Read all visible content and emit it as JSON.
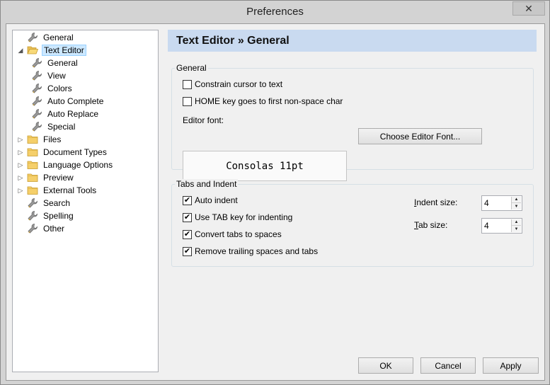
{
  "window": {
    "title": "Preferences",
    "close_glyph": "✕"
  },
  "tree": {
    "items": [
      {
        "label": "General",
        "icon": "wrench-icon",
        "level": 0,
        "expander": ""
      },
      {
        "label": "Text Editor",
        "icon": "folder-open-icon",
        "level": 0,
        "expander": "◢",
        "selected": true
      },
      {
        "label": "General",
        "icon": "wrench-icon",
        "level": 1,
        "expander": ""
      },
      {
        "label": "View",
        "icon": "wrench-icon",
        "level": 1,
        "expander": ""
      },
      {
        "label": "Colors",
        "icon": "wrench-icon",
        "level": 1,
        "expander": ""
      },
      {
        "label": "Auto Complete",
        "icon": "wrench-icon",
        "level": 1,
        "expander": ""
      },
      {
        "label": "Auto Replace",
        "icon": "wrench-icon",
        "level": 1,
        "expander": ""
      },
      {
        "label": "Special",
        "icon": "wrench-icon",
        "level": 1,
        "expander": ""
      },
      {
        "label": "Files",
        "icon": "folder-icon",
        "level": 0,
        "expander": "▷"
      },
      {
        "label": "Document Types",
        "icon": "folder-icon",
        "level": 0,
        "expander": "▷"
      },
      {
        "label": "Language Options",
        "icon": "folder-icon",
        "level": 0,
        "expander": "▷"
      },
      {
        "label": "Preview",
        "icon": "folder-icon",
        "level": 0,
        "expander": "▷"
      },
      {
        "label": "External Tools",
        "icon": "folder-icon",
        "level": 0,
        "expander": "▷"
      },
      {
        "label": "Search",
        "icon": "wrench-icon",
        "level": 0,
        "expander": ""
      },
      {
        "label": "Spelling",
        "icon": "wrench-icon",
        "level": 0,
        "expander": ""
      },
      {
        "label": "Other",
        "icon": "wrench-icon",
        "level": 0,
        "expander": ""
      }
    ]
  },
  "panel": {
    "header": "Text Editor » General",
    "general_group": {
      "title": "General",
      "constrain_cursor": {
        "label": "Constrain cursor to text",
        "checked": false
      },
      "home_key": {
        "label": "HOME key goes to first non-space char",
        "checked": false
      },
      "editor_font_label": "Editor font:",
      "editor_font_value": "Consolas 11pt",
      "choose_font_button": "Choose Editor Font..."
    },
    "tabs_group": {
      "title": "Tabs and Indent",
      "auto_indent": {
        "label": "Auto indent",
        "checked": true
      },
      "use_tab": {
        "label": "Use TAB key for indenting",
        "checked": true
      },
      "convert_tabs": {
        "label": "Convert tabs to spaces",
        "checked": true
      },
      "remove_trailing": {
        "label": "Remove trailing spaces and tabs",
        "checked": true
      },
      "indent_size": {
        "label_accel": "I",
        "label_rest": "ndent size:",
        "value": "4"
      },
      "tab_size": {
        "label_accel": "T",
        "label_rest": "ab size:",
        "value": "4"
      }
    }
  },
  "buttons": {
    "ok": "OK",
    "cancel": "Cancel",
    "apply": "Apply"
  },
  "colors": {
    "header_band": "#c9daf0",
    "selection": "#cce8ff",
    "dialog_bg": "#f0f0f0"
  }
}
